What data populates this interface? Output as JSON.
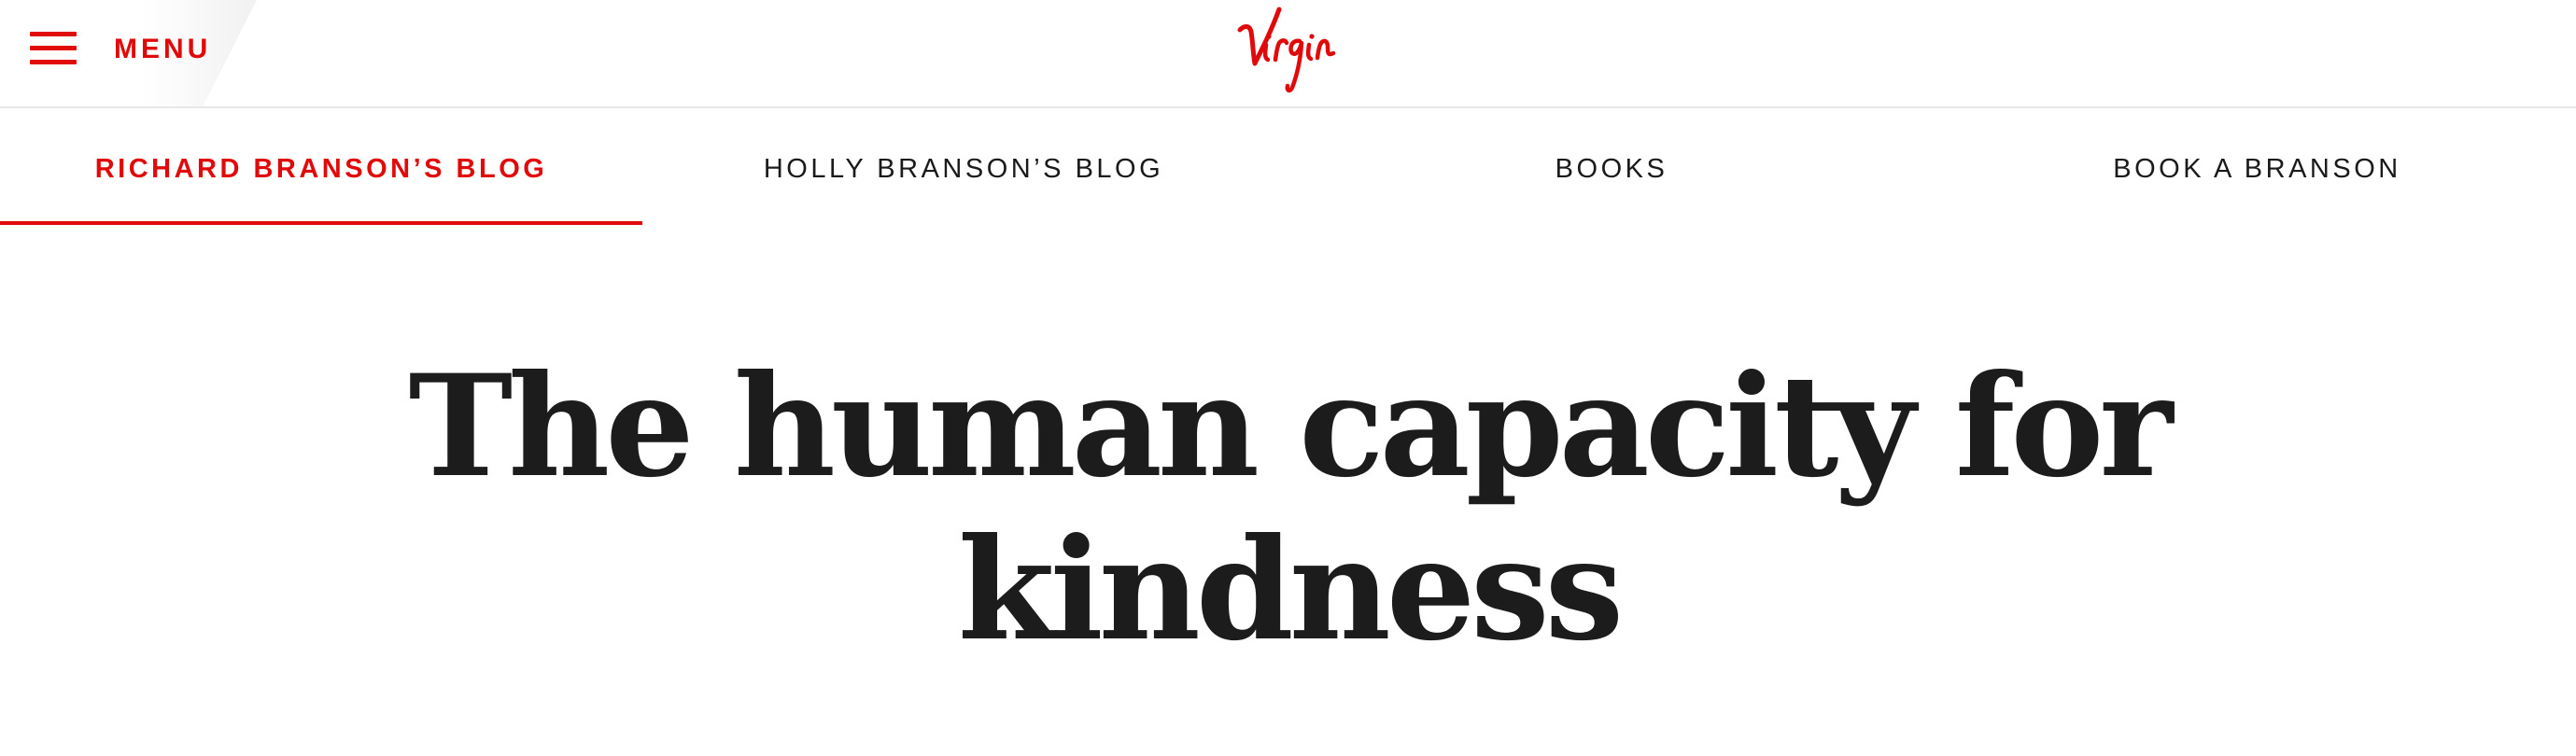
{
  "header": {
    "menu_label": "MENU",
    "menu_icon": "hamburger-icon",
    "logo_text": "Virgin",
    "logo_icon": "virgin-logo",
    "accent_color": "#e10a0a"
  },
  "nav": {
    "tabs": [
      {
        "label": "RICHARD BRANSON’S BLOG",
        "active": true
      },
      {
        "label": "HOLLY BRANSON’S BLOG",
        "active": false
      },
      {
        "label": "BOOKS",
        "active": false
      },
      {
        "label": "BOOK A BRANSON",
        "active": false
      }
    ]
  },
  "article": {
    "title_line1": "The human capacity for",
    "title_line2": "kindness"
  }
}
